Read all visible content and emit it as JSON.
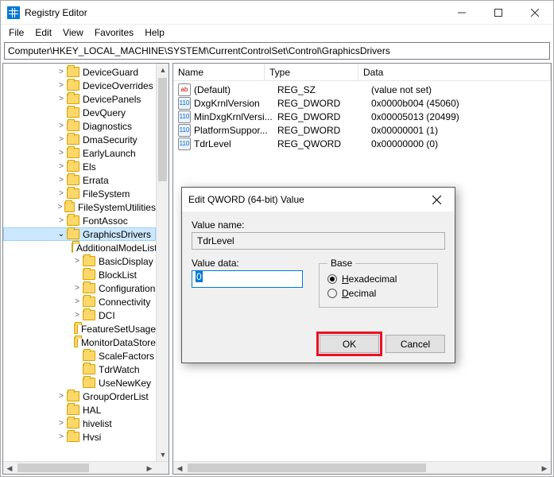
{
  "window": {
    "title": "Registry Editor"
  },
  "menu": {
    "file": "File",
    "edit": "Edit",
    "view": "View",
    "favorites": "Favorites",
    "help": "Help"
  },
  "address": "Computer\\HKEY_LOCAL_MACHINE\\SYSTEM\\CurrentControlSet\\Control\\GraphicsDrivers",
  "tree": {
    "items": [
      {
        "indent": 66,
        "chev": ">",
        "label": "DeviceGuard"
      },
      {
        "indent": 66,
        "chev": ">",
        "label": "DeviceOverrides"
      },
      {
        "indent": 66,
        "chev": ">",
        "label": "DevicePanels"
      },
      {
        "indent": 66,
        "chev": "",
        "label": "DevQuery"
      },
      {
        "indent": 66,
        "chev": ">",
        "label": "Diagnostics"
      },
      {
        "indent": 66,
        "chev": ">",
        "label": "DmaSecurity"
      },
      {
        "indent": 66,
        "chev": ">",
        "label": "EarlyLaunch"
      },
      {
        "indent": 66,
        "chev": ">",
        "label": "Els"
      },
      {
        "indent": 66,
        "chev": ">",
        "label": "Errata"
      },
      {
        "indent": 66,
        "chev": ">",
        "label": "FileSystem"
      },
      {
        "indent": 66,
        "chev": ">",
        "label": "FileSystemUtilities"
      },
      {
        "indent": 66,
        "chev": ">",
        "label": "FontAssoc"
      },
      {
        "indent": 66,
        "chev": "v",
        "label": "GraphicsDrivers",
        "selected": true
      },
      {
        "indent": 86,
        "chev": "",
        "label": "AdditionalModeLists"
      },
      {
        "indent": 86,
        "chev": ">",
        "label": "BasicDisplay"
      },
      {
        "indent": 86,
        "chev": "",
        "label": "BlockList"
      },
      {
        "indent": 86,
        "chev": ">",
        "label": "Configuration"
      },
      {
        "indent": 86,
        "chev": ">",
        "label": "Connectivity"
      },
      {
        "indent": 86,
        "chev": ">",
        "label": "DCI"
      },
      {
        "indent": 86,
        "chev": "",
        "label": "FeatureSetUsage"
      },
      {
        "indent": 86,
        "chev": "",
        "label": "MonitorDataStore"
      },
      {
        "indent": 86,
        "chev": "",
        "label": "ScaleFactors"
      },
      {
        "indent": 86,
        "chev": "",
        "label": "TdrWatch"
      },
      {
        "indent": 86,
        "chev": "",
        "label": "UseNewKey"
      },
      {
        "indent": 66,
        "chev": ">",
        "label": "GroupOrderList"
      },
      {
        "indent": 66,
        "chev": "",
        "label": "HAL"
      },
      {
        "indent": 66,
        "chev": ">",
        "label": "hivelist"
      },
      {
        "indent": 66,
        "chev": ">",
        "label": "Hvsi"
      }
    ]
  },
  "list": {
    "headers": {
      "name": "Name",
      "type": "Type",
      "data": "Data"
    },
    "rows": [
      {
        "icon": "str",
        "name": "(Default)",
        "type": "REG_SZ",
        "data": "(value not set)"
      },
      {
        "icon": "bin",
        "name": "DxgKrnlVersion",
        "type": "REG_DWORD",
        "data": "0x0000b004 (45060)"
      },
      {
        "icon": "bin",
        "name": "MinDxgKrnlVersi...",
        "type": "REG_DWORD",
        "data": "0x00005013 (20499)"
      },
      {
        "icon": "bin",
        "name": "PlatformSuppor...",
        "type": "REG_DWORD",
        "data": "0x00000001 (1)"
      },
      {
        "icon": "bin",
        "name": "TdrLevel",
        "type": "REG_QWORD",
        "data": "0x00000000 (0)"
      }
    ]
  },
  "dialog": {
    "title": "Edit QWORD (64-bit) Value",
    "value_name_label": "Value name:",
    "value_name": "TdrLevel",
    "value_data_label": "Value data:",
    "value_data": "0",
    "base_label": "Base",
    "hex_label": "Hexadecimal",
    "dec_label": "Decimal",
    "ok": "OK",
    "cancel": "Cancel"
  }
}
